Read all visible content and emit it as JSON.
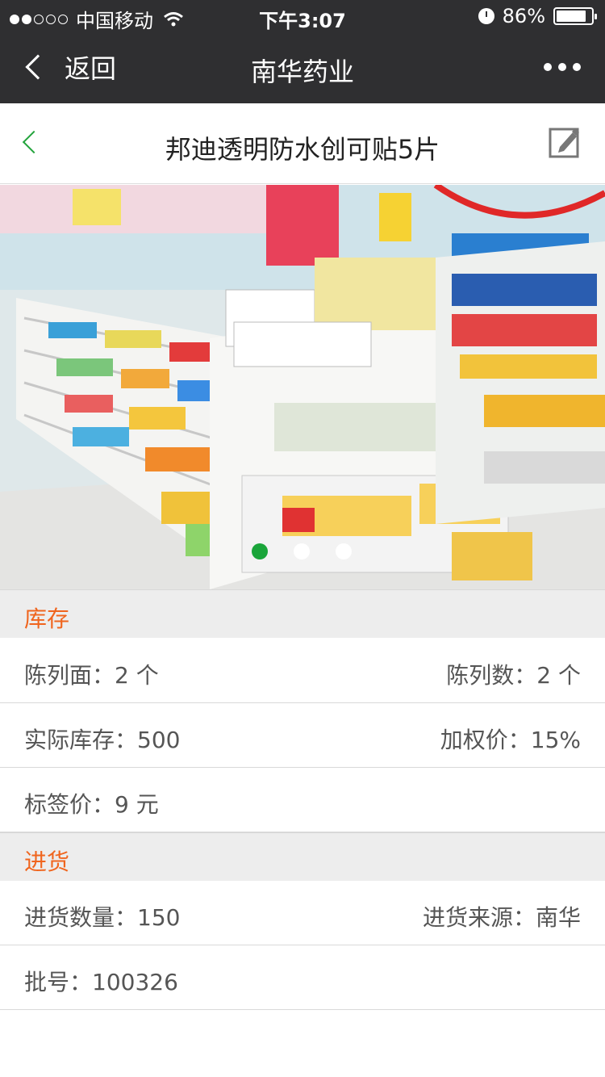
{
  "status_bar": {
    "carrier": "中国移动",
    "time": "下午3:07",
    "battery": "86%",
    "battery_level": 0.86,
    "signal_bars": 2
  },
  "navbar": {
    "back_label": "返回",
    "title": "南华药业"
  },
  "product": {
    "title": "邦迪透明防水创可贴5片"
  },
  "carousel": {
    "count": 3,
    "active_index": 0,
    "accent_color": "#1aa53a"
  },
  "inventory": {
    "section_title": "库存",
    "display_face": "陈列面：2 个",
    "display_count": "陈列数：2 个",
    "actual_stock": "实际库存：500",
    "weighted_price": "加权价：15%",
    "label_price": "标签价：9 元"
  },
  "purchase": {
    "section_title": "进货",
    "quantity": "进货数量：150",
    "source": "进货来源：南华",
    "batch": "批号：100326"
  }
}
